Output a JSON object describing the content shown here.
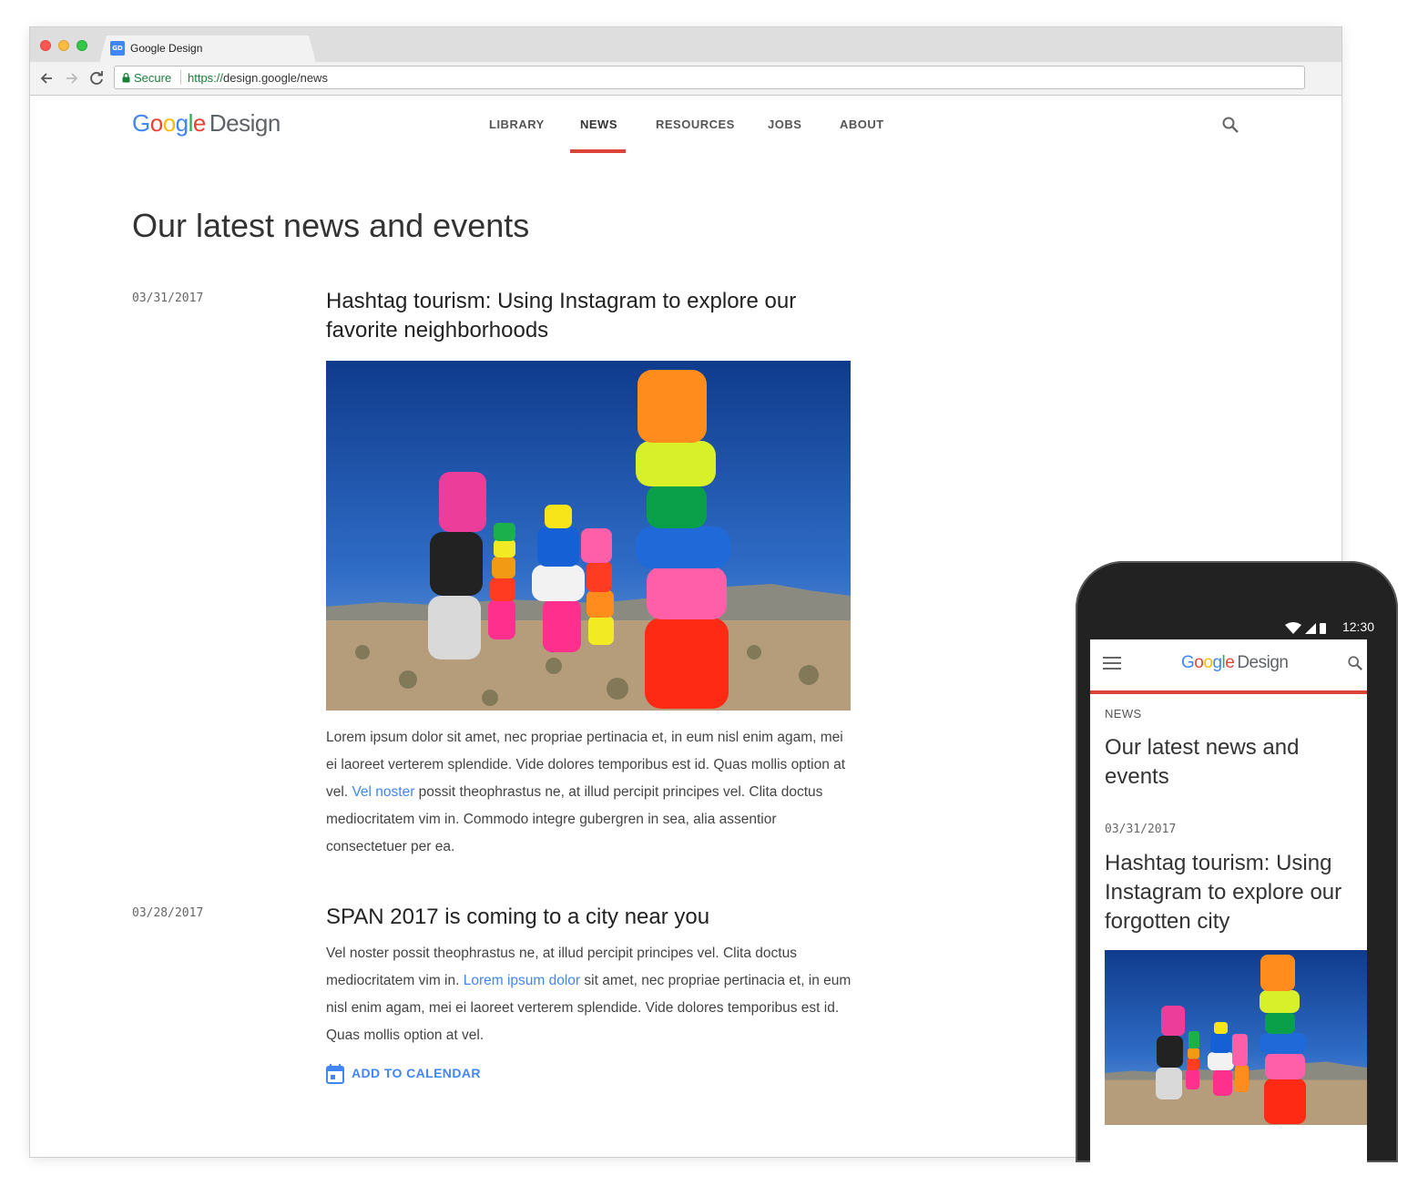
{
  "browser": {
    "tab_title": "Google Design",
    "favicon_text": "GD",
    "secure_label": "Secure",
    "url_scheme": "https://",
    "url_rest": "design.google/news"
  },
  "site": {
    "logo_letters": [
      "G",
      "o",
      "o",
      "g",
      "l",
      "e"
    ],
    "logo_suffix": "Design",
    "nav": [
      {
        "label": "LIBRARY",
        "active": false
      },
      {
        "label": "NEWS",
        "active": true
      },
      {
        "label": "RESOURCES",
        "active": false
      },
      {
        "label": "JOBS",
        "active": false
      },
      {
        "label": "ABOUT",
        "active": false
      }
    ],
    "accent_red": "#db4437",
    "link_blue": "#4285f4"
  },
  "main": {
    "page_title": "Our latest news and events",
    "posts": [
      {
        "date": "03/31/2017",
        "title": "Hashtag tourism: Using Instagram to explore our favorite neighborhoods",
        "body_before": "Lorem ipsum dolor sit amet, nec propriae pertinacia et, in eum nisl enim agam, mei ei laoreet verterem splendide. Vide dolores temporibus est id. Quas mollis option at vel. ",
        "body_link": "Vel noster",
        "body_after": " possit theophrastus ne, at illud percipit principes vel. Clita doctus mediocritatem vim in. Commodo integre gubergren in sea, alia assentior consectetuer per ea."
      },
      {
        "date": "03/28/2017",
        "title": "SPAN 2017 is coming to a city near you",
        "body_before": "Vel noster possit theophrastus ne, at illud percipit principes vel. Clita doctus mediocritatem vim in. ",
        "body_link": "Lorem ipsum dolor",
        "body_after": " sit amet, nec propriae pertinacia et, in eum nisl enim agam, mei ei laoreet verterem splendide. Vide dolores temporibus est id. Quas mollis option at vel.",
        "action_label": "ADD TO CALENDAR"
      }
    ]
  },
  "mobile": {
    "time": "12:30",
    "section_label": "NEWS",
    "page_title": "Our latest news and events",
    "post_date": "03/31/2017",
    "post_title": "Hashtag tourism: Using Instagram to explore our forgotten city"
  }
}
